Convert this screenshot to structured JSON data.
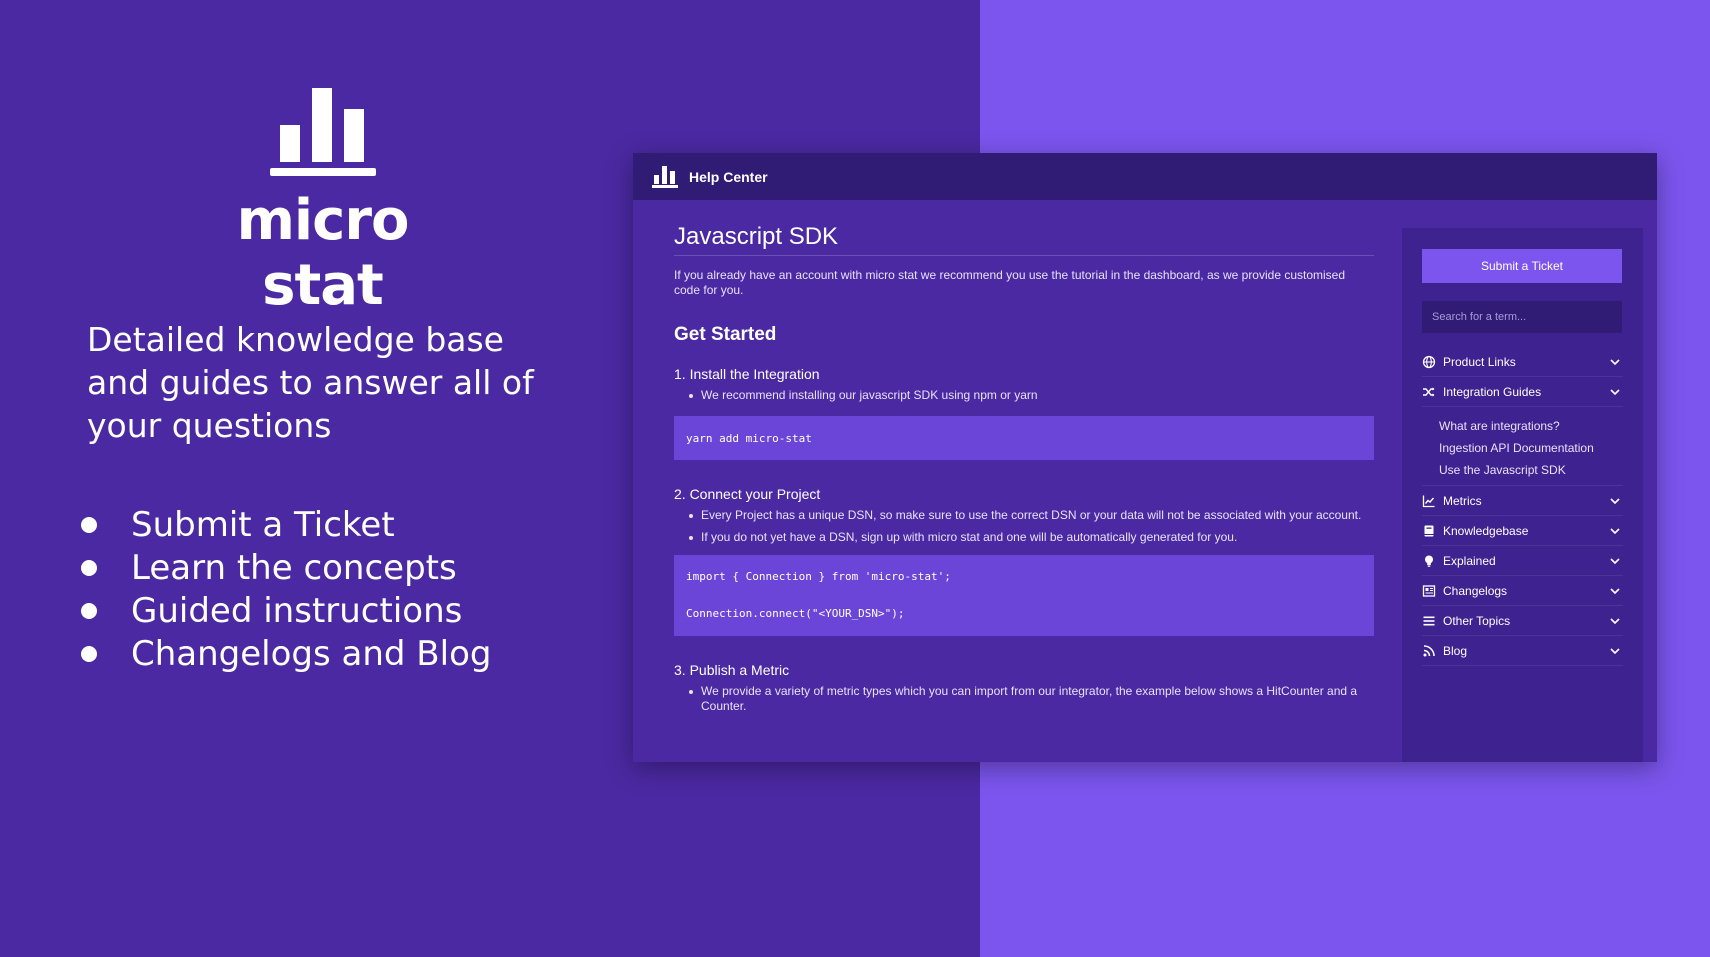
{
  "brand": {
    "name": "micro stat",
    "tagline": "Detailed knowledge base and guides to answer all of your questions",
    "features": [
      "Submit a Ticket",
      "Learn the concepts",
      "Guided instructions",
      "Changelogs and Blog"
    ]
  },
  "colors": {
    "bg_left": "#4b29a2",
    "bg_right": "#7c55ee",
    "topbar": "#311c75",
    "sidebar": "#3e2290",
    "code_block": "#6b45d8",
    "accent_button": "#7c55ee"
  },
  "app": {
    "title": "Help Center",
    "logo_icon": "bar-chart-icon"
  },
  "article": {
    "title": "Javascript SDK",
    "intro": "If you already have an account with micro stat we recommend you use the tutorial in the dashboard, as we provide customised code for you.",
    "section_title": "Get Started",
    "steps": [
      {
        "heading": "1. Install the Integration",
        "bullets": [
          "We recommend installing our javascript SDK using npm or yarn"
        ],
        "code": [
          "yarn add micro-stat"
        ]
      },
      {
        "heading": "2. Connect your Project",
        "bullets": [
          "Every Project has a unique DSN, so make sure to use the correct DSN or your data will not be associated with your account.",
          "If you do not yet have a DSN, sign up with micro stat and one will be automatically generated for you."
        ],
        "code": [
          "import { Connection } from 'micro-stat';",
          "Connection.connect(\"<YOUR_DSN>\");"
        ]
      },
      {
        "heading": "3. Publish a Metric",
        "bullets": [
          "We provide a variety of metric types which you can import from our integrator, the example below shows a HitCounter and a Counter."
        ]
      }
    ]
  },
  "sidebar": {
    "ticket_button": "Submit a Ticket",
    "search_placeholder": "Search for a term...",
    "nav": [
      {
        "label": "Product Links",
        "icon": "globe-icon"
      },
      {
        "label": "Integration Guides",
        "icon": "shuffle-icon",
        "children": [
          "What are integrations?",
          "Ingestion API Documentation",
          "Use the Javascript SDK"
        ]
      },
      {
        "label": "Metrics",
        "icon": "line-chart-icon"
      },
      {
        "label": "Knowledgebase",
        "icon": "book-icon"
      },
      {
        "label": "Explained",
        "icon": "lightbulb-icon"
      },
      {
        "label": "Changelogs",
        "icon": "newspaper-icon"
      },
      {
        "label": "Other Topics",
        "icon": "list-icon"
      },
      {
        "label": "Blog",
        "icon": "rss-icon"
      }
    ]
  }
}
